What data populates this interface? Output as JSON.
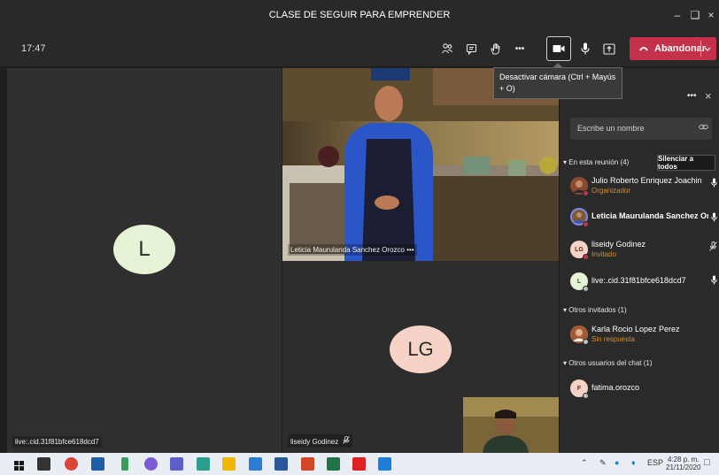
{
  "window": {
    "title": "CLASE DE SEGUIR PARA EMPRENDER",
    "minimize_icon": "minimize-icon",
    "maximize_icon": "maximize-icon",
    "close_icon": "close-icon"
  },
  "toolbar": {
    "time": "17:47",
    "leave_label": "Abandonar",
    "camera_tooltip": "Desactivar cámara (Ctrl + Mayús + O)"
  },
  "stage": {
    "tile_left": {
      "initial": "L",
      "name": "live:.cid.31f81bfce618dcd7"
    },
    "tile_video": {
      "name": "Leticia Maurulanda Sanchez Orozco",
      "more": "•••"
    },
    "tile_bottom": {
      "initial": "LG",
      "name": "liseidy Godinez"
    }
  },
  "panel": {
    "more": "•••",
    "close": "×",
    "search_placeholder": "Escribe un nombre",
    "in_meeting_label": "En esta reunión (4)",
    "mute_all_label": "Silenciar a todos",
    "others_invited_label": "Otros invitados (1)",
    "chat_users_label": "Otros usuarios del chat (1)",
    "participants": [
      {
        "name": "Julio Roberto Enriquez Joachin",
        "role": "Organizador"
      },
      {
        "name": "Leticia Maurulanda Sanchez Or...",
        "role": ""
      },
      {
        "initials": "LG",
        "name": "liseidy Godinez",
        "role": "Invitado"
      },
      {
        "initials": "L",
        "name": "live:.cid.31f81bfce618dcd7",
        "role": ""
      }
    ],
    "invited": [
      {
        "name": "Karla Rocio Lopez Perez",
        "role": "Sin respuesta"
      }
    ],
    "chat_users": [
      {
        "initials": "F",
        "name": "fatima.orozco"
      }
    ]
  },
  "taskbar": {
    "language": "ESP",
    "time": "4:28 p. m.",
    "date": "21/11/2020"
  },
  "colors": {
    "leave_red": "#c4314b",
    "organizer_orange": "#d48f2f",
    "avatar_green": "#e7f3d6",
    "avatar_peach": "#f6d3c6"
  }
}
